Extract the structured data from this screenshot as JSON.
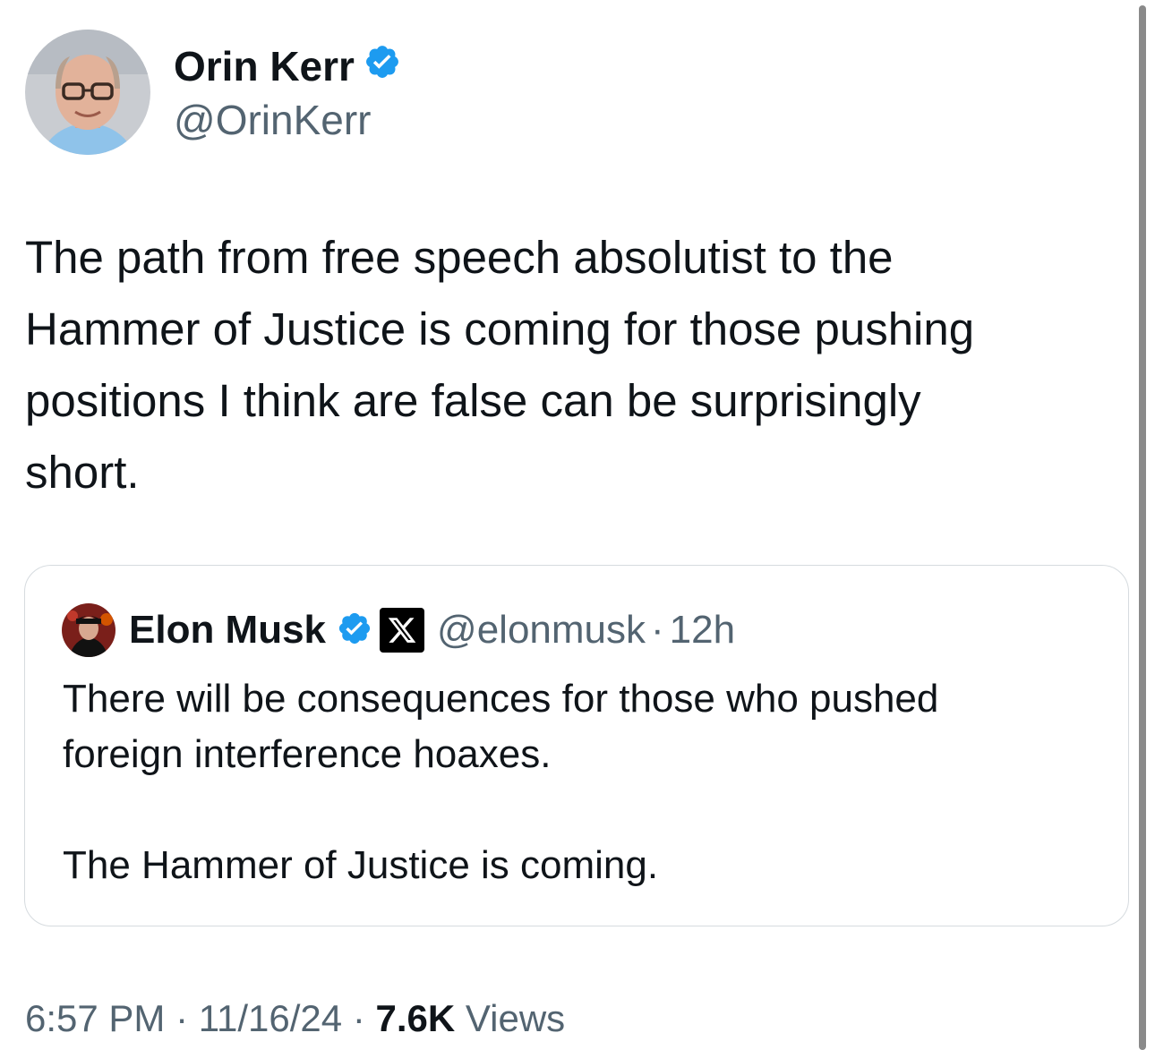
{
  "tweet": {
    "author_name": "Orin Kerr",
    "author_handle": "@OrinKerr",
    "text": "The path from free speech absolutist to the\nHammer of Justice is coming for those pushing\npositions I think are false can be surprisingly\nshort.",
    "timestamp_time": "6:57 PM",
    "timestamp_date": "11/16/24",
    "views_count": "7.6K",
    "views_label": "Views",
    "separator": "·"
  },
  "quoted_tweet": {
    "author_name": "Elon Musk",
    "author_handle": "@elonmusk",
    "time_ago": "12h",
    "separator": "·",
    "badge_glyph": "𝕏",
    "text": "There will be consequences for those who pushed\nforeign interference hoaxes.\n\nThe Hammer of Justice is coming."
  },
  "icons": {
    "verified": "verified-badge-icon",
    "affiliate": "x-logo-icon"
  },
  "colors": {
    "verified_blue": "#1d9bf0",
    "text_primary": "#0f1419",
    "text_secondary": "#536471",
    "border": "#d6dbdf"
  }
}
